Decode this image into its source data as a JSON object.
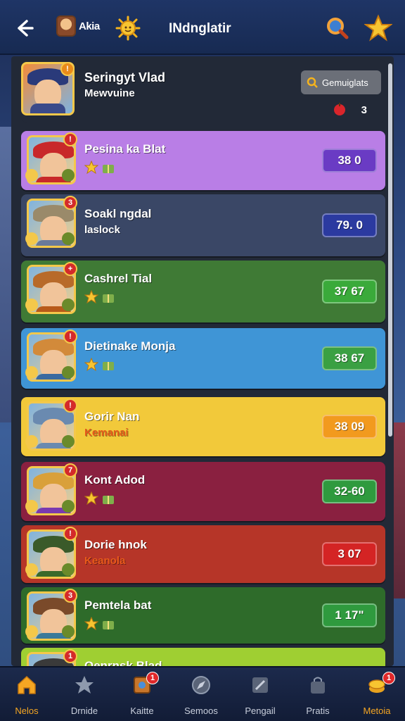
{
  "header": {
    "user_name": "Akia",
    "title": "INdnglatir",
    "icons": [
      "back-arrow-icon",
      "sun-icon",
      "search-icon",
      "star-icon"
    ]
  },
  "top_card": {
    "name": "Seringyt Vlad",
    "subtitle": "Mewvuine",
    "button_label": "Gemuiglats",
    "count": "3"
  },
  "rows": [
    {
      "name": "Pesina ka Blat",
      "sub": "",
      "score": "38  0",
      "bg": "#b97ee6",
      "score_bg": "#6a3bc4",
      "badge": "!"
    },
    {
      "name": "Soakl ngdal",
      "sub": "laslock",
      "score": "79. 0",
      "bg": "#3a4766",
      "score_bg": "#2b3aa0",
      "badge": "3"
    },
    {
      "name": "Cashrel Tial",
      "sub": "",
      "score": "37  67",
      "bg": "#3f7a35",
      "score_bg": "#3aaa3a",
      "badge": "+"
    },
    {
      "name": "Dietinake Monja",
      "sub": "",
      "score": "38  67",
      "bg": "#3f95d6",
      "score_bg": "#3aa043",
      "badge": "!"
    },
    {
      "name": "Gorir Nan",
      "sub": "Kemanai",
      "score": "38  09",
      "bg": "#f2c93a",
      "score_bg": "#f29a1e",
      "badge": "!"
    },
    {
      "name": "Kont Adod",
      "sub": "",
      "score": "32-60",
      "bg": "#8a2040",
      "score_bg": "#2f9a3e",
      "badge": "7"
    },
    {
      "name": "Dorie hnok",
      "sub": "Keanola",
      "score": "3  07",
      "bg": "#b63528",
      "score_bg": "#d42424",
      "badge": "!"
    },
    {
      "name": "Pemtela bat",
      "sub": "",
      "score": "1  17\"",
      "bg": "#2e6b2a",
      "score_bg": "#2f9a3e",
      "badge": "3"
    },
    {
      "name": "Oenrnsk Blad",
      "sub": "",
      "score": "",
      "bg": "#9fcf32",
      "score_bg": "#2f7a2e",
      "badge": "1"
    }
  ],
  "nav": [
    {
      "label": "Nelos",
      "icon": "home-icon",
      "badge": ""
    },
    {
      "label": "Drnide",
      "icon": "star-icon",
      "badge": ""
    },
    {
      "label": "Kaitte",
      "icon": "cards-icon",
      "badge": "1"
    },
    {
      "label": "Semoos",
      "icon": "compass-icon",
      "badge": ""
    },
    {
      "label": "Pengail",
      "icon": "pencil-icon",
      "badge": ""
    },
    {
      "label": "Pratis",
      "icon": "bag-icon",
      "badge": ""
    },
    {
      "label": "Metoia",
      "icon": "coins-icon",
      "badge": "1"
    }
  ]
}
